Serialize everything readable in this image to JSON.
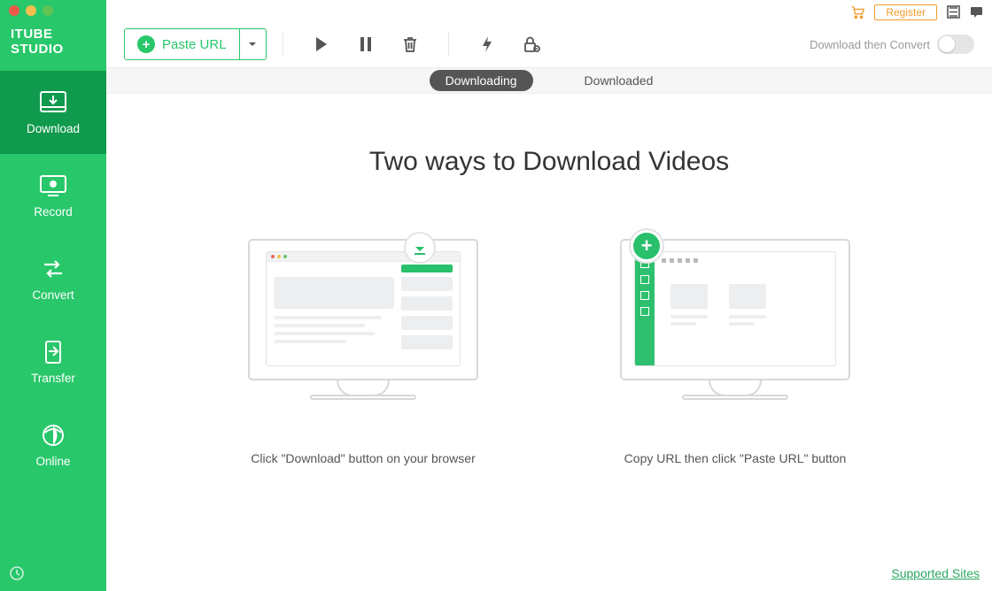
{
  "brand": "ITUBE STUDIO",
  "sidebar": {
    "items": [
      {
        "label": "Download",
        "icon": "download-tray-icon"
      },
      {
        "label": "Record",
        "icon": "record-monitor-icon"
      },
      {
        "label": "Convert",
        "icon": "convert-arrows-icon"
      },
      {
        "label": "Transfer",
        "icon": "transfer-device-icon"
      },
      {
        "label": "Online",
        "icon": "globe-icon"
      }
    ],
    "active_index": 0
  },
  "top": {
    "register_label": "Register"
  },
  "toolbar": {
    "paste_label": "Paste URL",
    "download_then_convert_label": "Download then Convert"
  },
  "tabs": {
    "items": [
      {
        "label": "Downloading"
      },
      {
        "label": "Downloaded"
      }
    ],
    "active_index": 0
  },
  "content": {
    "heading": "Two ways to Download Videos",
    "caption1": "Click \"Download\" button on your browser",
    "caption2": "Copy URL then click \"Paste URL\" button"
  },
  "footer": {
    "supported_sites_label": "Supported Sites"
  },
  "colors": {
    "accent": "#28c76a",
    "accent_dark": "#0f9a4d",
    "orange": "#f39b2a"
  }
}
